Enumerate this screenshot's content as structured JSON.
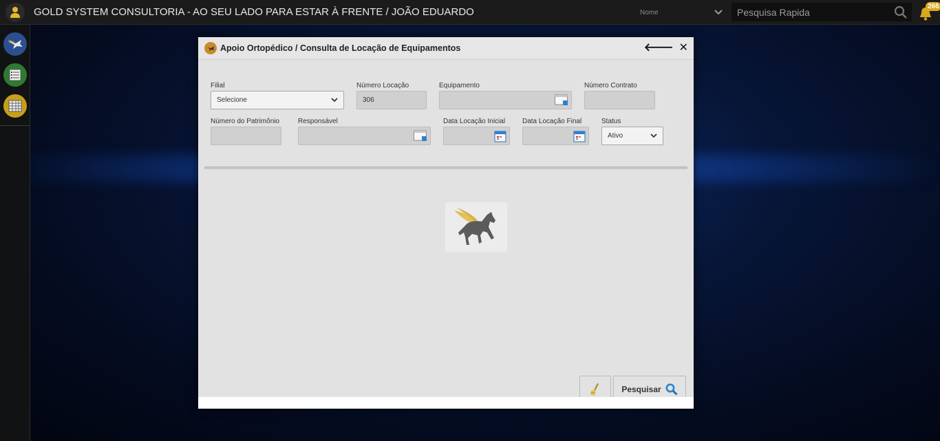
{
  "topbar": {
    "title": "GOLD SYSTEM CONSULTORIA - AO SEU LADO PARA ESTAR À FRENTE / JOÃO EDUARDO",
    "search_filter": "Nome",
    "search_placeholder": "Pesquisa Rapida",
    "notifications_count": "266"
  },
  "sidebar": {
    "items": [
      {
        "icon": "pegasus-icon",
        "color": "#2b4f8f"
      },
      {
        "icon": "list-icon",
        "color": "#2f7a32"
      },
      {
        "icon": "grid-icon",
        "color": "#c7a01a"
      }
    ]
  },
  "dialog": {
    "title": "Apoio Ortopédico / Consulta de Locação de Equipamentos",
    "fields": {
      "filial": {
        "label": "Filial",
        "value": "Selecione"
      },
      "numero_locacao": {
        "label": "Número Locação",
        "value": "306"
      },
      "equipamento": {
        "label": "Equipamento",
        "value": ""
      },
      "numero_contrato": {
        "label": "Número Contrato",
        "value": ""
      },
      "numero_patrimonio": {
        "label": "Número do Patrimônio",
        "value": ""
      },
      "responsavel": {
        "label": "Responsável",
        "value": ""
      },
      "data_inicial": {
        "label": "Data Locação Inicial",
        "value": ""
      },
      "data_final": {
        "label": "Data Locação Final",
        "value": ""
      },
      "status": {
        "label": "Status",
        "value": "Ativo"
      }
    },
    "buttons": {
      "search": "Pesquisar"
    }
  }
}
